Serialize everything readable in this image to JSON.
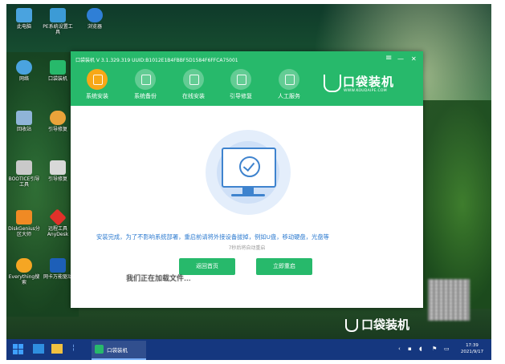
{
  "desktop": {
    "icons": [
      {
        "label": "此电脑",
        "color": "#4aa3df"
      },
      {
        "label": "PE系统设置工具",
        "color": "#3c9bd6"
      },
      {
        "label": "浏览器",
        "color": "#2f7fd6"
      },
      {
        "label": "网络",
        "color": "#4aa3df"
      },
      {
        "label": "口袋装机",
        "color": "#27b96b"
      },
      {
        "label": "回收站",
        "color": "#8fb4d8"
      },
      {
        "label": "引导修复",
        "color": "#e9a33a"
      },
      {
        "label": "BOOTICE引导工具",
        "color": "#c9c9c9"
      },
      {
        "label": "引导修复",
        "color": "#d8d8d8"
      },
      {
        "label": "DiskGenius分区大师",
        "color": "#f08a24"
      },
      {
        "label": "远程工具AnyDesk",
        "color": "#e0312a"
      },
      {
        "label": "Everything搜索",
        "color": "#f5a623"
      },
      {
        "label": "网卡万能驱动",
        "color": "#1d5fb8"
      }
    ]
  },
  "window": {
    "title": "口袋装机 V 3.1.329.319 UUID:B1012E1B4FBBF5D1584F6FFCA75001",
    "menu_icon": "≡",
    "minimize_icon": "—",
    "close_icon": "✕",
    "tabs": [
      {
        "label": "系统安装",
        "active": true
      },
      {
        "label": "系统备份",
        "active": false
      },
      {
        "label": "在线安装",
        "active": false
      },
      {
        "label": "引导修复",
        "active": false
      },
      {
        "label": "人工服务",
        "active": false
      }
    ],
    "brand": {
      "name": "口袋装机",
      "url": "WWW.KOUDAIPE.COM"
    },
    "message": "安装完成，为了不影响系统部署，重启前请将外接设备拔掉，例如U盘，移动硬盘，光盘等",
    "countdown": "7秒后将自动重启",
    "buttons": {
      "back": "返回首页",
      "restart": "立即重启"
    },
    "accent": "#27b96b"
  },
  "overlay_text": "我们正在加载文件...",
  "watermark_brand": "口袋装机",
  "taskbar": {
    "app_label": "口袋装机",
    "tray_icons": [
      "network-icon",
      "volume-icon",
      "flag-icon",
      "screen-icon"
    ],
    "time": "17:39",
    "date": "2021/9/17"
  }
}
